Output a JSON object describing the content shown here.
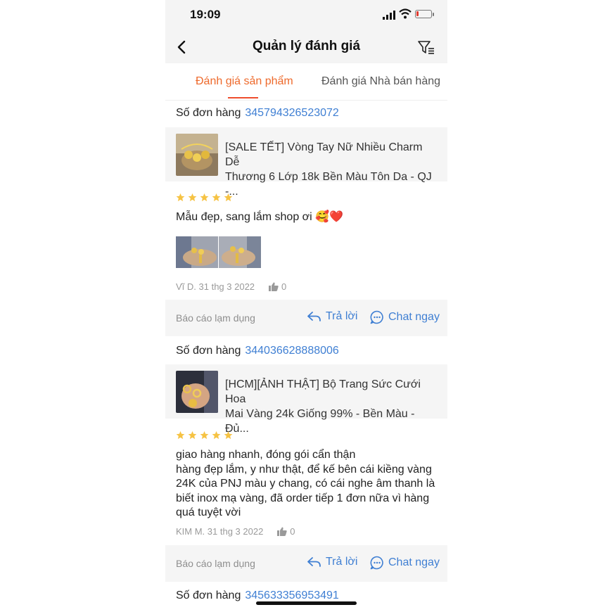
{
  "status": {
    "time": "19:09"
  },
  "nav": {
    "title": "Quản lý đánh giá"
  },
  "tabs": [
    {
      "label": "Đánh giá sản phẩm",
      "active": true
    },
    {
      "label": "Đánh giá Nhà bán hàng",
      "active": false
    }
  ],
  "colors": {
    "accent": "#ee6a2c",
    "link": "#3f7fd3",
    "star": "#f6c344"
  },
  "order_label": "Số đơn hàng",
  "reviews": [
    {
      "order_number": "345794326523072",
      "product_line1": "[SALE TẾT] Vòng Tay Nữ Nhiều Charm Dễ",
      "product_line2": "Thương 6 Lớp 18k Bền Màu Tôn Da - QJ -...",
      "rating": 5,
      "comment": "Mẫu đẹp, sang lắm shop ơi 🥰❤️",
      "photo_count": 2,
      "author_date": "Vĩ D. 31 thg 3 2022",
      "likes": "0",
      "report_label": "Báo cáo lạm dụng",
      "reply_label": "Trả lời",
      "chat_label": "Chat ngay"
    },
    {
      "order_number": "344036628888006",
      "product_line1": "[HCM][ẢNH THẬT] Bộ Trang Sức Cưới Hoa",
      "product_line2": "Mai Vàng 24k Giống 99% - Bền Màu - Đủ...",
      "rating": 5,
      "comment_lines": [
        "giao hàng nhanh, đóng gói cẩn thận",
        "hàng đẹp lắm, y như thật, để kế bên cái kiềng vàng",
        "24K của PNJ màu y chang, có cái nghe âm thanh là",
        "biết inox mạ vàng, đã order tiếp 1 đơn nữa vì hàng",
        "quá tuyệt vời"
      ],
      "author_date": "KIM M. 31 thg 3 2022",
      "likes": "0",
      "report_label": "Báo cáo lạm dụng",
      "reply_label": "Trả lời",
      "chat_label": "Chat ngay"
    },
    {
      "order_number": "345633356953491"
    }
  ]
}
